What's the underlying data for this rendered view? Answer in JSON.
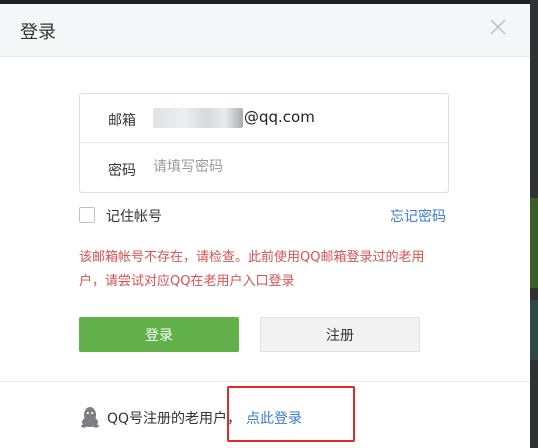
{
  "dialog": {
    "title": "登录"
  },
  "form": {
    "email_label": "邮箱",
    "email_suffix": "@qq.com",
    "password_label": "密码",
    "password_placeholder": "请填写密码"
  },
  "remember": {
    "label": "记住帐号",
    "checked": false
  },
  "forgot_label": "忘记密码",
  "error_message": "该邮箱帐号不存在，请检查。此前使用QQ邮箱登录过的老用户，请尝试对应QQ在老用户入口登录",
  "buttons": {
    "login_label": "登录",
    "register_label": "注册"
  },
  "footer": {
    "text": "QQ号注册的老用户，",
    "link_label": "点此登录"
  },
  "colors": {
    "accent_green": "#62b049",
    "link_blue": "#3a7bd5",
    "error_red": "#d9534f",
    "highlight_red": "#e02b2b"
  },
  "icons": {
    "close": "close-icon",
    "qq": "qq-penguin-icon"
  }
}
